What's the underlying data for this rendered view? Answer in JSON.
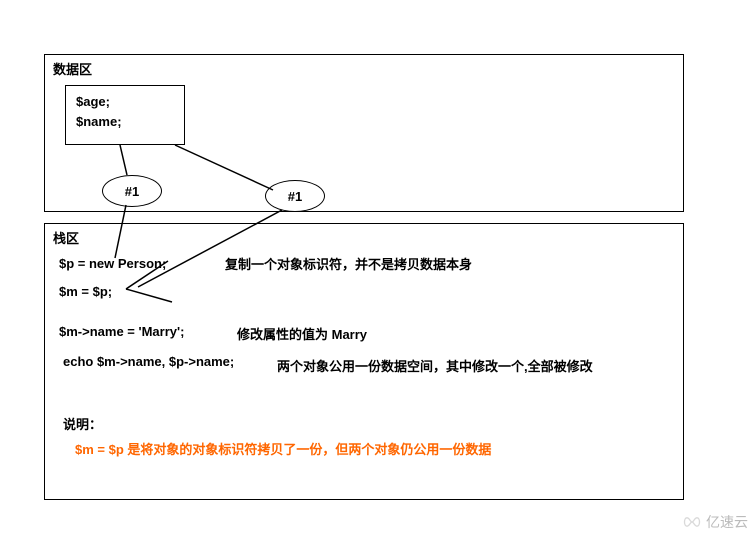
{
  "data_area": {
    "title": "数据区",
    "vars": {
      "line1": "$age;",
      "line2": "$name;"
    },
    "pointer1": "#1",
    "pointer2": "#1"
  },
  "stack_area": {
    "title": "栈区",
    "line1": {
      "code": "$p = new Person;",
      "comment": "复制一个对象标识符，并不是拷贝数据本身"
    },
    "line2": {
      "code": "$m = $p;"
    },
    "line3": {
      "code": "$m->name = 'Marry';",
      "comment": "修改属性的值为 Marry"
    },
    "line4": {
      "code": "echo $m->name, $p->name;",
      "comment": "两个对象公用一份数据空间，其中修改一个,全部被修改"
    },
    "note_label": "说明：",
    "note_body": "$m = $p 是将对象的对象标识符拷贝了一份，但两个对象仍公用一份数据"
  },
  "watermark": "亿速云"
}
